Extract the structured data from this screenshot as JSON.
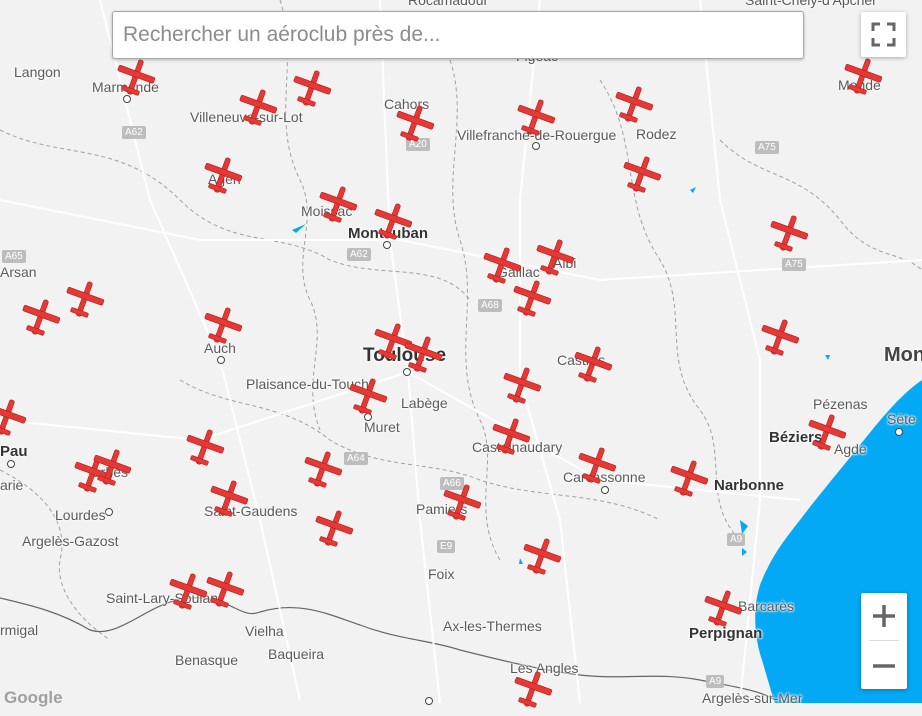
{
  "search": {
    "placeholder": "Rechercher un aéroclub près de..."
  },
  "attribution": "Google",
  "colors": {
    "sea": "#03a9f4",
    "plane": "#e53935",
    "land": "#f2f2f2"
  },
  "icons": {
    "fullscreen": "fullscreen-icon",
    "zoom_in": "plus-icon",
    "zoom_out": "minus-icon",
    "marker": "airplane-icon"
  },
  "places": [
    "Langon",
    "Marmande",
    "Villeneuve-sur-Lot",
    "Cahors",
    "Villefranche-de-Rouergue",
    "Rodez",
    "Mende",
    "Agen",
    "Moissac",
    "Montauban",
    "Arsan",
    "Gaillac",
    "Albi",
    "Auch",
    "Toulouse",
    "Castres",
    "Mon",
    "Plaisance-du-Touch",
    "Labège",
    "Pézenas",
    "Sète",
    "Muret",
    "Béziers",
    "Agde",
    "Pau",
    "Tarbes",
    "arie",
    "Castelnaudary",
    "Carcassonne",
    "Narbonne",
    "Lourdes",
    "Saint-Gaudens",
    "Pamiers",
    "Argelès-Gazost",
    "Foix",
    "Saint-Lary-Soulan",
    "Barcarès",
    "Perpignan",
    "rmigal",
    "Vielha",
    "Ax-les-Thermes",
    "Benasque",
    "Baqueira",
    "Les Angles",
    "Argelès-sur-Mer",
    "Rocamadour",
    "Saint-Chely-d'Apcher",
    "Figeac"
  ],
  "roads": [
    "A62",
    "A20",
    "A75",
    "A65",
    "A62",
    "A68",
    "A75",
    "A64",
    "A66",
    "E9",
    "A9",
    "A9"
  ]
}
